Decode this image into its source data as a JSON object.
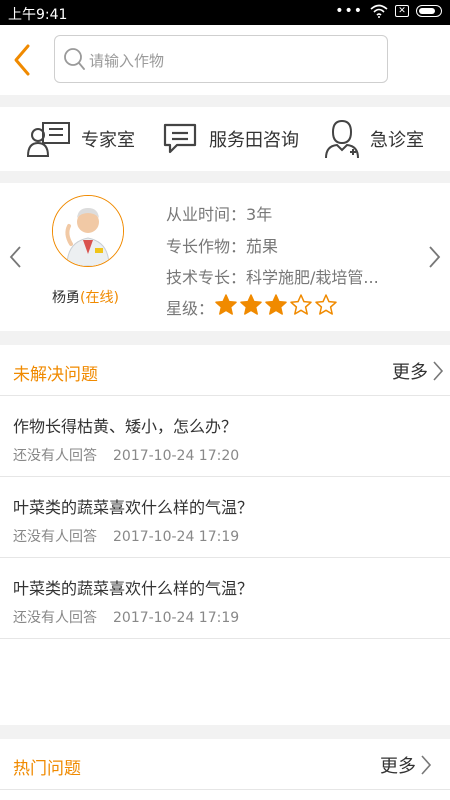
{
  "statusbar": {
    "time": "上午9:41",
    "sim_icon": "✕"
  },
  "search": {
    "placeholder": "请输入作物",
    "value": ""
  },
  "menu": [
    {
      "label": "专家室",
      "icon": "expert-board-icon"
    },
    {
      "label": "服务田咨询",
      "icon": "chat-bubble-icon"
    },
    {
      "label": "急诊室",
      "icon": "doctor-icon"
    }
  ],
  "expert": {
    "name": "杨勇",
    "status": "(在线)",
    "years_label": "从业时间：",
    "years_value": "3年",
    "crop_label": "专长作物：",
    "crop_value": "茄果",
    "skill_label": "技术专长：",
    "skill_value": "科学施肥/栽培管...",
    "rating_label": "星级：",
    "rating": 3,
    "rating_max": 5
  },
  "unsolved": {
    "title": "未解决问题",
    "more": "更多",
    "items": [
      {
        "question": "作物长得枯黄、矮小，怎么办？",
        "status": "还没有人回答",
        "time": "2017-10-24 17:20"
      },
      {
        "question": "叶菜类的蔬菜喜欢什么样的气温？",
        "status": "还没有人回答",
        "time": "2017-10-24 17:19"
      },
      {
        "question": "叶菜类的蔬菜喜欢什么样的气温？",
        "status": "还没有人回答",
        "time": "2017-10-24 17:19"
      }
    ]
  },
  "hot": {
    "title": "热门问题",
    "more": "更多"
  },
  "colors": {
    "accent": "#f08a00",
    "star": "#f08a00",
    "background": "#f2f2f2"
  }
}
